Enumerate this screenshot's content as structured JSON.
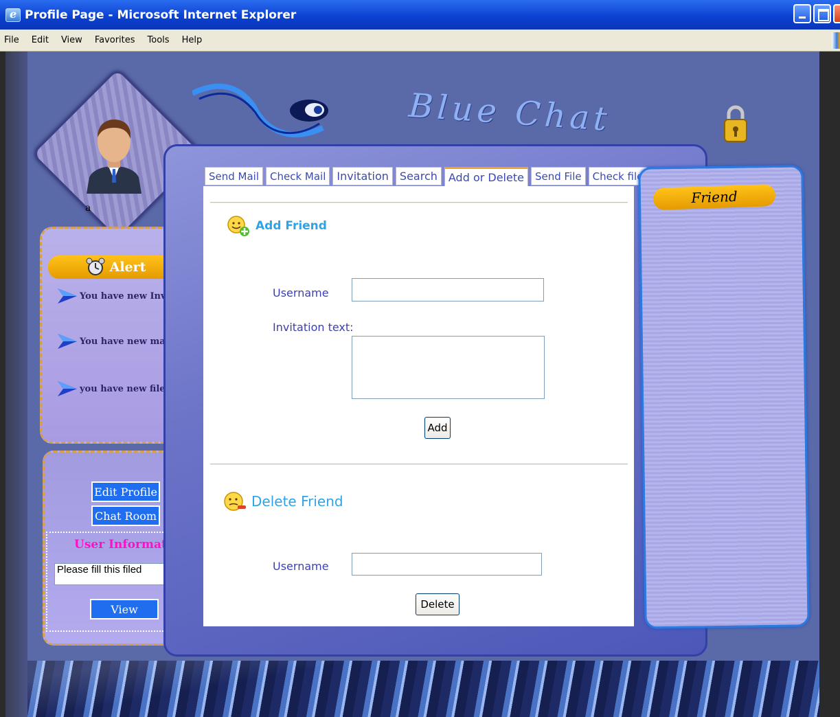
{
  "window": {
    "title": "Profile Page - Microsoft Internet Explorer"
  },
  "menu": [
    "File",
    "Edit",
    "View",
    "Favorites",
    "Tools",
    "Help"
  ],
  "banner": {
    "logo_text": "Blue Chat"
  },
  "profile": {
    "username": "a"
  },
  "alert": {
    "title": "Alert",
    "items": [
      "You have new Invitation",
      "You have new mail",
      "you have new file"
    ]
  },
  "side": {
    "edit_profile": "Edit Profile",
    "chat_room": "Chat Room",
    "user_info_title": "User Information",
    "user_info_placeholder": "Please fill this filed",
    "view": "View"
  },
  "tabs": [
    {
      "label": "Send Mail",
      "active": false
    },
    {
      "label": "Check Mail",
      "active": false
    },
    {
      "label": "Invitation",
      "active": false
    },
    {
      "label": "Search",
      "active": false
    },
    {
      "label": "Add or Delete",
      "active": true
    },
    {
      "label": "Send File",
      "active": false
    },
    {
      "label": "Check file",
      "active": false
    }
  ],
  "add_friend": {
    "title": "Add Friend",
    "username_label": "Username",
    "username_value": "",
    "invitation_label": "Invitation text:",
    "invitation_value": "",
    "button": "Add"
  },
  "delete_friend": {
    "title": "Delete Friend",
    "username_label": "Username",
    "username_value": "",
    "button": "Delete"
  },
  "friend_panel": {
    "title": "Friend"
  },
  "colors": {
    "page_bg": "#5a69a8",
    "accent_orange": "#f0a000",
    "section_title": "#2fa3e6",
    "label_text": "#3b3fb5",
    "side_button": "#1f6ef0",
    "user_info_title": "#ff10c8"
  }
}
